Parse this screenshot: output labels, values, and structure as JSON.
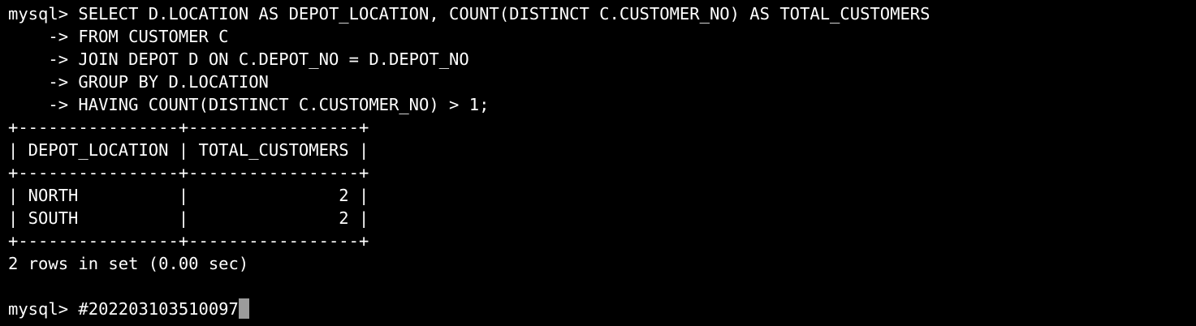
{
  "terminal": {
    "lines": [
      "mysql> SELECT D.LOCATION AS DEPOT_LOCATION, COUNT(DISTINCT C.CUSTOMER_NO) AS TOTAL_CUSTOMERS",
      "    -> FROM CUSTOMER C",
      "    -> JOIN DEPOT D ON C.DEPOT_NO = D.DEPOT_NO",
      "    -> GROUP BY D.LOCATION",
      "    -> HAVING COUNT(DISTINCT C.CUSTOMER_NO) > 1;",
      "+----------------+-----------------+",
      "| DEPOT_LOCATION | TOTAL_CUSTOMERS |",
      "+----------------+-----------------+",
      "| NORTH          |               2 |",
      "| SOUTH          |               2 |",
      "+----------------+-----------------+",
      "2 rows in set (0.00 sec)",
      "",
      "mysql> #202203103510097"
    ],
    "cursor_color": "#9b9b9b",
    "background_color": "#000000",
    "text_color": "#ffffff"
  }
}
